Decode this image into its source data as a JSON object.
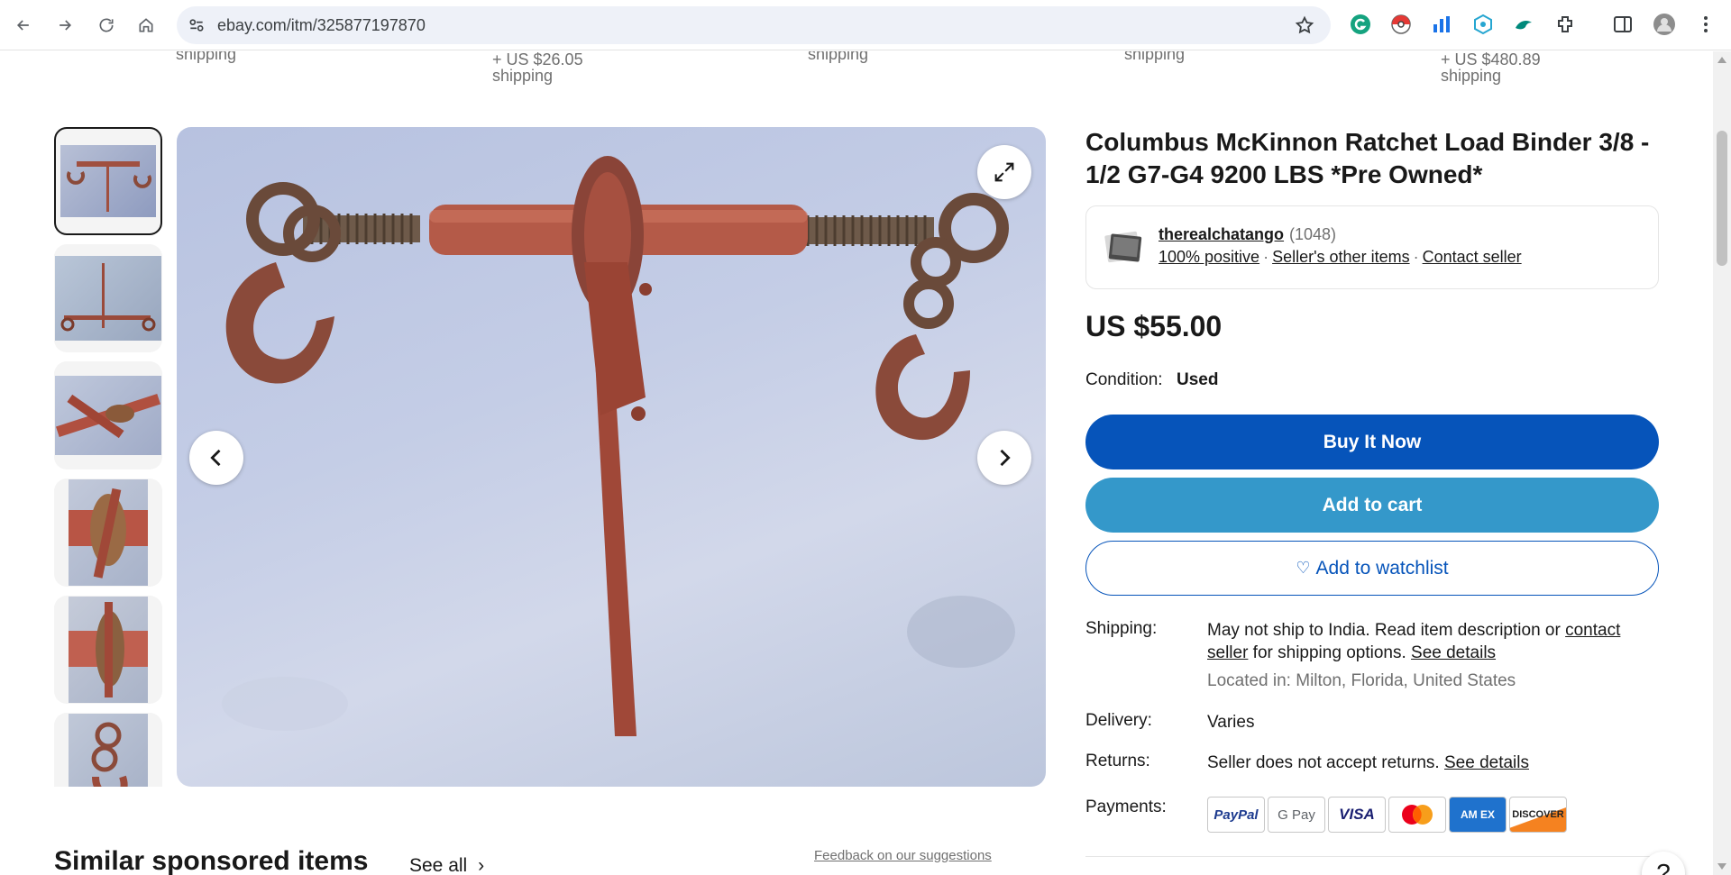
{
  "browser": {
    "url": "ebay.com/itm/325877197870"
  },
  "shipping_strip": [
    {
      "cost": "",
      "label": "shipping"
    },
    {
      "cost": "+ US $26.05",
      "label": "shipping"
    },
    {
      "cost": "",
      "label": "shipping"
    },
    {
      "cost": "",
      "label": "shipping"
    },
    {
      "cost": "+ US $480.89",
      "label": "shipping"
    }
  ],
  "gallery": {
    "thumbnail_count": 6,
    "selected_index": 0
  },
  "listing": {
    "title": "Columbus McKinnon Ratchet Load Binder 3/8 - 1/2 G7-G4 9200 LBS *Pre Owned*",
    "price": "US $55.00",
    "condition_label": "Condition:",
    "condition_value": "Used"
  },
  "seller": {
    "name": "therealchatango",
    "feedback_count": "(1048)",
    "positive": "100% positive",
    "other_items": "Seller's other items",
    "contact": "Contact seller",
    "sep": "·"
  },
  "actions": {
    "buy_now": "Buy It Now",
    "add_to_cart": "Add to cart",
    "add_to_watchlist": "Add to watchlist"
  },
  "details": {
    "shipping_label": "Shipping:",
    "shipping_text_1": "May not ship to India. Read item description or ",
    "shipping_link_1": "contact seller",
    "shipping_text_2": " for shipping options. ",
    "shipping_link_2": "See details",
    "located": "Located in: Milton, Florida, United States",
    "delivery_label": "Delivery:",
    "delivery_value": "Varies",
    "returns_label": "Returns:",
    "returns_value": "Seller does not accept returns. ",
    "returns_link": "See details",
    "payments_label": "Payments:"
  },
  "payments": {
    "paypal": "PayPal",
    "gpay": "G Pay",
    "visa": "VISA",
    "amex": "AM EX",
    "discover": "DISCOVER"
  },
  "similar": {
    "heading": "Similar sponsored items",
    "see_all": "See all",
    "feedback": "Feedback on our suggestions"
  },
  "help": "?",
  "colors": {
    "buy_now": "#0654ba",
    "add_to_cart": "#3498ca"
  }
}
